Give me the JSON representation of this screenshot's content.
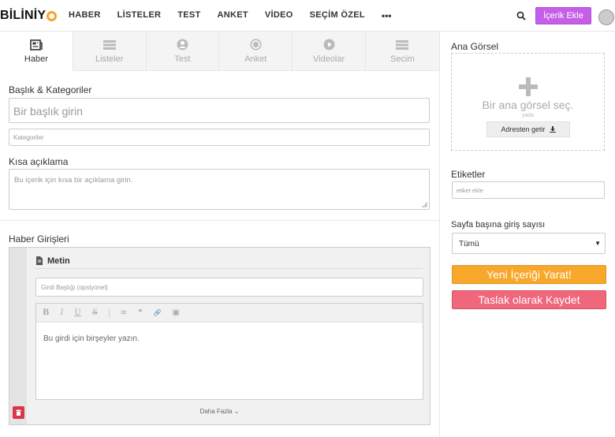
{
  "brand": {
    "logo_prefix": "BİLİNİY",
    "accent": "#c55fe8"
  },
  "nav": {
    "items": [
      "HABER",
      "LİSTELER",
      "TEST",
      "ANKET",
      "VİDEO",
      "SEÇİM ÖZEL"
    ],
    "more": "•••"
  },
  "header": {
    "add_button": "İçerik Ekle"
  },
  "tabs": [
    {
      "label": "Haber",
      "icon": "news-icon"
    },
    {
      "label": "Listeler",
      "icon": "list-icon"
    },
    {
      "label": "Test",
      "icon": "user-circle-icon"
    },
    {
      "label": "Anket",
      "icon": "radio-icon"
    },
    {
      "label": "Videolar",
      "icon": "play-icon"
    },
    {
      "label": "Secim",
      "icon": "stack-icon"
    }
  ],
  "form": {
    "section_title": "Başlık & Kategoriler",
    "title_placeholder": "Bir başlık girin",
    "category_placeholder": "Kategoriler",
    "summary_label": "Kısa açıklama",
    "summary_placeholder": "Bu içerik için kısa bir açıklama girin.",
    "entries_label": "Haber Girişleri",
    "entry_type": "Metin",
    "entry_title_placeholder": "Girdi Başlığı (opsiyonel)",
    "editor_placeholder": "Bu girdi için birşeyler yazın.",
    "more_label": "Daha Fazla ⌄",
    "toolbar": [
      "B",
      "I",
      "U",
      "S",
      "≡",
      "❝",
      "🔗",
      "▣"
    ]
  },
  "sidebar": {
    "main_image_label": "Ana Görsel",
    "main_image_prompt": "Bir ana görsel seç.",
    "or_text": "yada",
    "fetch_button": "Adresten getir",
    "tags_label": "Etiketler",
    "tags_placeholder": "etiket ekle",
    "per_page_label": "Sayfa başına giriş sayısı",
    "per_page_value": "Tümü",
    "create_button": "Yeni İçeriği Yarat!",
    "draft_button": "Taslak olarak Kaydet"
  }
}
